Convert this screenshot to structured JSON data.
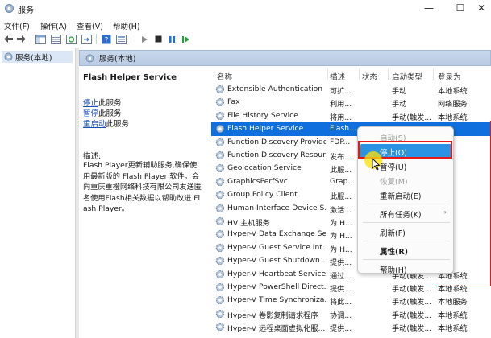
{
  "window": {
    "title": "服务",
    "minimize": "—",
    "maximize": "☐",
    "close": "✕"
  },
  "menu": [
    "文件(F)",
    "操作(A)",
    "查看(V)",
    "帮助(H)"
  ],
  "tree": {
    "root_label": "服务(本地)"
  },
  "panel": {
    "header": "服务(本地)"
  },
  "details": {
    "service_name": "Flash Helper Service",
    "links": [
      {
        "key": "停止",
        "suffix": "此服务"
      },
      {
        "key": "暂停",
        "suffix": "此服务"
      },
      {
        "key": "重启动",
        "suffix": "此服务"
      }
    ],
    "description_label": "描述:",
    "description": "Flash Player更新辅助服务,确保使用最新版的 Flash Player 软件。会向重庆重橙网络科技有限公司发送匿名使用Flash相关数据以帮助改进 Flash Player。"
  },
  "columns": [
    "名称",
    "描述",
    "状态",
    "启动类型",
    "登录为"
  ],
  "services": [
    {
      "name": "Extensible Authentication ...",
      "desc": "可扩...",
      "status": "",
      "startup": "手动",
      "logon": "本地系统"
    },
    {
      "name": "Fax",
      "desc": "利用...",
      "status": "",
      "startup": "手动",
      "logon": "网络服务"
    },
    {
      "name": "File History Service",
      "desc": "将用...",
      "status": "",
      "startup": "手动(触发...",
      "logon": "本地系统"
    },
    {
      "name": "Flash Helper Service",
      "desc": "Flash...",
      "status": "",
      "startup": "",
      "logon": "系统"
    },
    {
      "name": "Function Discovery Provide...",
      "desc": "FDP...",
      "status": "",
      "startup": "",
      "logon": "服务"
    },
    {
      "name": "Function Discovery Resour...",
      "desc": "发布...",
      "status": "",
      "startup": "",
      "logon": "服务"
    },
    {
      "name": "Geolocation Service",
      "desc": "此服...",
      "status": "",
      "startup": "",
      "logon": "系统"
    },
    {
      "name": "GraphicsPerfSvc",
      "desc": "Grap...",
      "status": "",
      "startup": "",
      "logon": "系统"
    },
    {
      "name": "Group Policy Client",
      "desc": "此服...",
      "status": "",
      "startup": "",
      "logon": "系统"
    },
    {
      "name": "Human Interface Device S...",
      "desc": "激活...",
      "status": "",
      "startup": "",
      "logon": "系统"
    },
    {
      "name": "HV 主机服务",
      "desc": "为 H...",
      "status": "",
      "startup": "",
      "logon": "系统"
    },
    {
      "name": "Hyper-V Data Exchange Se...",
      "desc": "为 H...",
      "status": "",
      "startup": "",
      "logon": "系统"
    },
    {
      "name": "Hyper-V Guest Service Int...",
      "desc": "为 H...",
      "status": "",
      "startup": "",
      "logon": "系统"
    },
    {
      "name": "Hyper-V Guest Shutdown ...",
      "desc": "提供...",
      "status": "",
      "startup": "",
      "logon": "系统"
    },
    {
      "name": "Hyper-V Heartbeat Service",
      "desc": "通过...",
      "status": "",
      "startup": "手动(触发...",
      "logon": "本地系统"
    },
    {
      "name": "Hyper-V PowerShell Direct...",
      "desc": "提供...",
      "status": "",
      "startup": "手动(触发...",
      "logon": "本地系统"
    },
    {
      "name": "Hyper-V Time Synchroniza...",
      "desc": "将此...",
      "status": "",
      "startup": "手动(触发...",
      "logon": "本地服务"
    },
    {
      "name": "Hyper-V 卷影复制请求程序",
      "desc": "协调...",
      "status": "",
      "startup": "手动(触发...",
      "logon": "本地系统"
    },
    {
      "name": "Hyper-V 远程桌面虚拟化服...",
      "desc": "提供...",
      "status": "",
      "startup": "手动(触发...",
      "logon": "本地系统"
    }
  ],
  "selected_index": 3,
  "context_menu": [
    {
      "label": "启动(S)",
      "disabled": true
    },
    {
      "label": "停止(O)",
      "highlighted": true
    },
    {
      "label": "暂停(U)"
    },
    {
      "label": "恢复(M)",
      "disabled": true
    },
    {
      "label": "重新启动(E)"
    },
    {
      "separator": true
    },
    {
      "label": "所有任务(K)",
      "submenu": true
    },
    {
      "separator": true
    },
    {
      "label": "刷新(F)"
    },
    {
      "separator": true
    },
    {
      "label": "属性(R)",
      "bold": true
    },
    {
      "separator": true
    },
    {
      "label": "帮助(H)"
    }
  ],
  "colors": {
    "selection": "#0f6fdc",
    "highlight": "#2b93e3",
    "annotation": "#e81818",
    "link": "#1a4fbe"
  }
}
